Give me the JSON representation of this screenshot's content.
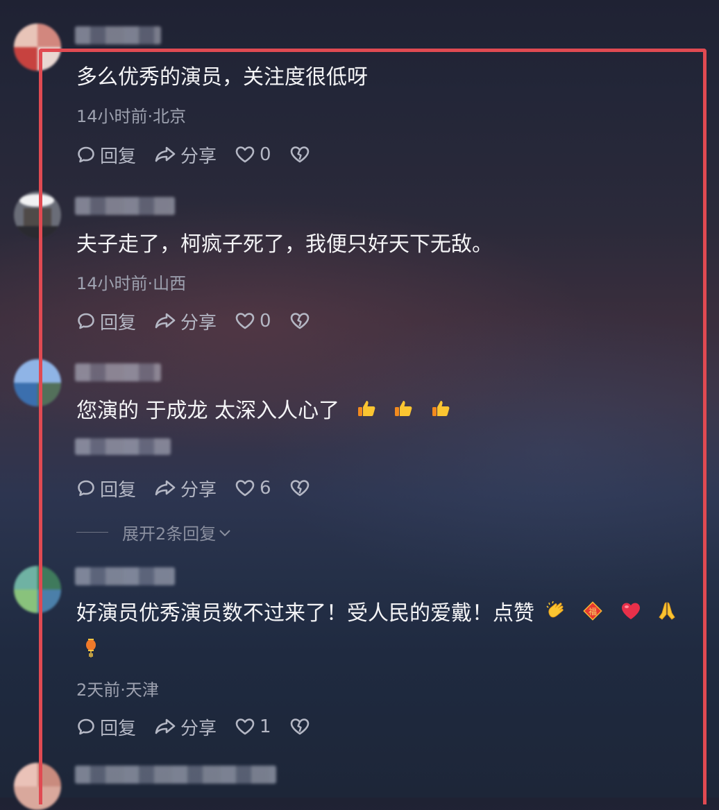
{
  "comments": [
    {
      "text": "多么优秀的演员，关注度很低呀",
      "meta": "14小时前·北京",
      "reply_label": "回复",
      "share_label": "分享",
      "like_count": "0"
    },
    {
      "text": "夫子走了，柯疯子死了，我便只好天下无敌。",
      "meta": "14小时前·山西",
      "reply_label": "回复",
      "share_label": "分享",
      "like_count": "0"
    },
    {
      "text": "您演的 于成龙 太深入人心了",
      "emojis": [
        "thumbs-up-emoji",
        "thumbs-up-emoji",
        "thumbs-up-emoji"
      ],
      "reply_label": "回复",
      "share_label": "分享",
      "like_count": "6",
      "expand_label": "展开2条回复"
    },
    {
      "text": "好演员优秀演员数不过来了！受人民的爱戴！点赞",
      "emojis": [
        "clapping-hands-emoji",
        "fu-diamond-emoji",
        "red-heart-emoji",
        "folded-hands-emoji",
        "lantern-emoji"
      ],
      "meta": "2天前·天津",
      "reply_label": "回复",
      "share_label": "分享",
      "like_count": "1"
    }
  ],
  "colors": {
    "frame": "#e04a52",
    "meta_text": "#9ea2b0",
    "action_text": "#b4b7c4"
  }
}
